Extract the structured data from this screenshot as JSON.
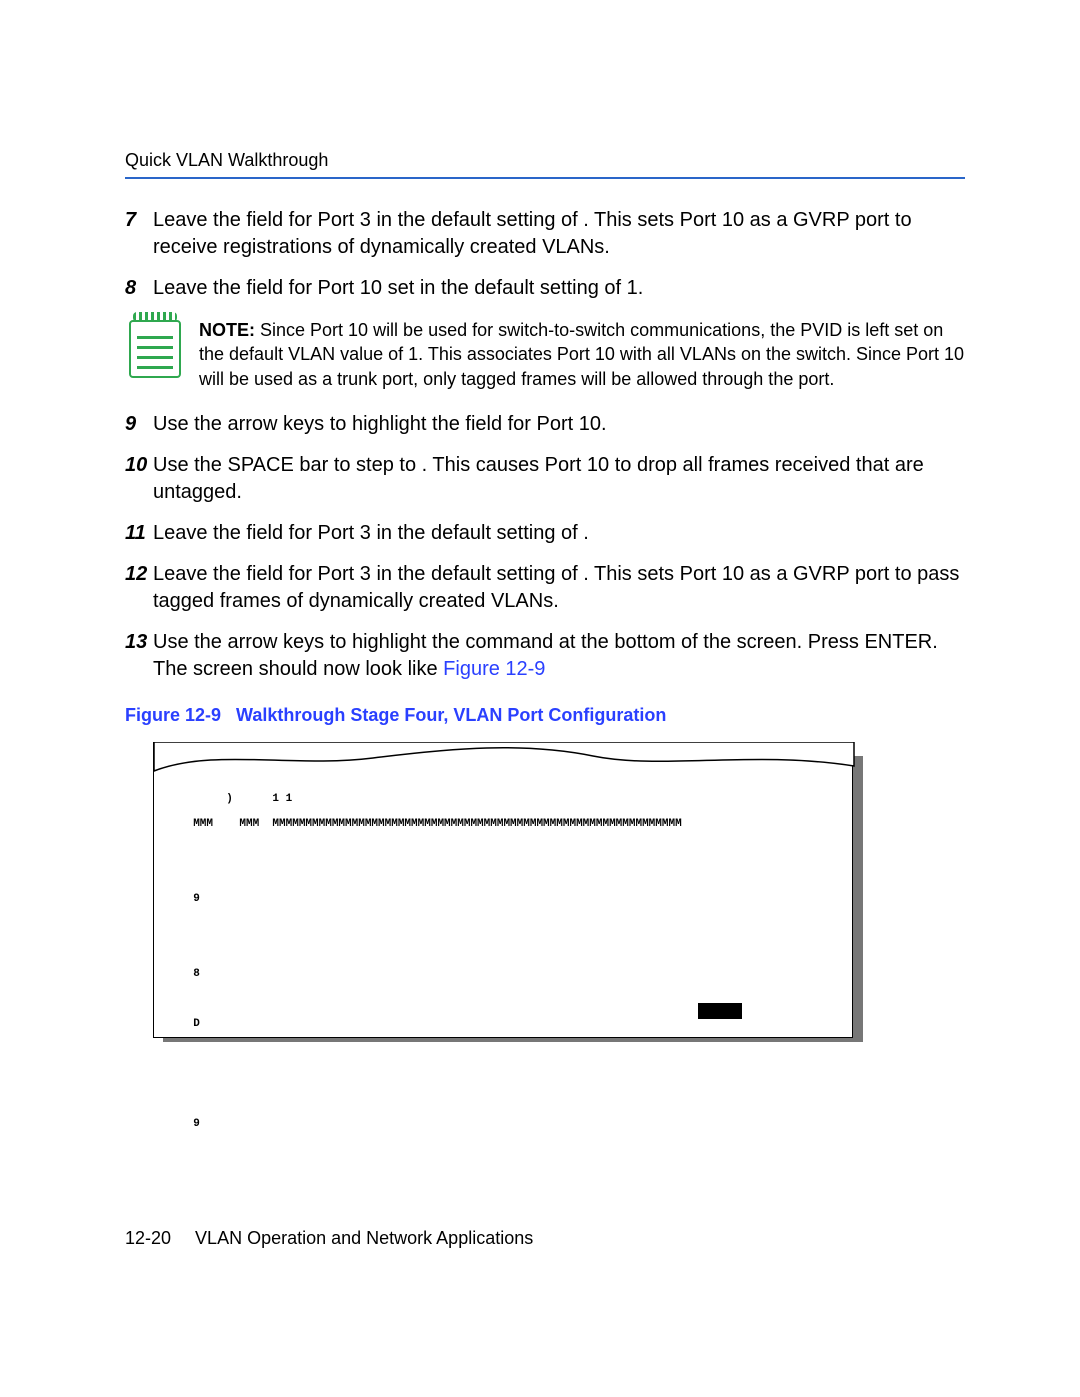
{
  "header": {
    "section_title": "Quick VLAN Walkthrough"
  },
  "steps": {
    "s7": {
      "num": "7",
      "text": "Leave the                         field for Port 3 in the default setting of            . This sets Port 10 as a GVRP port to receive registrations of dynamically created VLANs."
    },
    "s8": {
      "num": "8",
      "text": "Leave the         field for Port 10 set in the default setting of 1."
    },
    "s9": {
      "num": "9",
      "text": "Use the arrow keys to highlight the                                    field for Port 10."
    },
    "s10": {
      "num": "10",
      "text": "Use the SPACE bar to step to                                                      . This causes Port 10 to drop all frames received that are untagged."
    },
    "s11": {
      "num": "11",
      "text": "Leave the                               field for Port 3 in the default setting of             ."
    },
    "s12": {
      "num": "12",
      "text": "Leave the                         field for Port 3 in the default setting of            . This sets Port 10 as a GVRP port to pass tagged frames of dynamically created VLANs."
    },
    "s13": {
      "num": "13",
      "pre": "Use the arrow keys to highlight the        command at the bottom of the screen. Press ENTER. The screen should now look like ",
      "ref": "Figure 12-9"
    }
  },
  "note": {
    "label": "NOTE:",
    "body": "  Since Port 10 will be used for switch-to-switch communications, the PVID is left set on the default VLAN value of 1. This associates Port 10 with all VLANs on the switch. Since Port 10 will be used as a trunk port, only tagged frames will be allowed through the port."
  },
  "figure": {
    "caption_prefix": "Figure 12-9",
    "caption_title": "Walkthrough Stage Four, VLAN Port Configuration"
  },
  "terminal": {
    "l1": "       )      1 1",
    "l2": "  MMM    MMM  MMMMMMMMMMMMMMMMMMMMMMMMMMMMMMMMMMMMMMMMMMMMMMMMMMMMMMMMMMMMMM",
    "l3": "  9",
    "l4": "  8",
    "l5": "  D",
    "l6": "  9"
  },
  "footer": {
    "page_number": "12-20",
    "doc_title": "VLAN Operation and Network Applications"
  }
}
